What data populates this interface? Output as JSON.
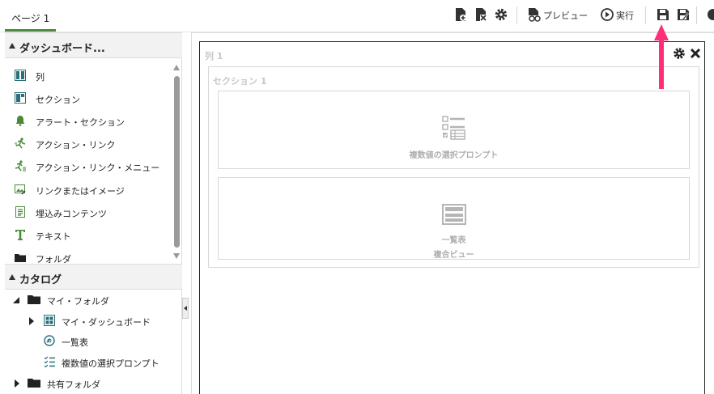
{
  "topbar": {
    "page_tab": "ページ 1",
    "preview_label": "プレビュー",
    "run_label": "実行"
  },
  "components_panel": {
    "title": "ダッシュボード...",
    "items": [
      {
        "label": "列",
        "icon": "column-icon"
      },
      {
        "label": "セクション",
        "icon": "section-icon"
      },
      {
        "label": "アラート・セクション",
        "icon": "bell-icon"
      },
      {
        "label": "アクション・リンク",
        "icon": "action-link-icon"
      },
      {
        "label": "アクション・リンク・メニュー",
        "icon": "action-link-menu-icon"
      },
      {
        "label": "リンクまたはイメージ",
        "icon": "link-image-icon"
      },
      {
        "label": "埋込みコンテンツ",
        "icon": "embedded-content-icon"
      },
      {
        "label": "テキスト",
        "icon": "text-icon"
      },
      {
        "label": "フォルダ",
        "icon": "folder-icon"
      }
    ]
  },
  "catalog_panel": {
    "title": "カタログ",
    "items": [
      {
        "label": "マイ・フォルダ",
        "icon": "folder-icon"
      },
      {
        "label": "マイ・ダッシュボード",
        "icon": "dashboard-icon"
      },
      {
        "label": "一覧表",
        "icon": "analysis-icon"
      },
      {
        "label": "複数値の選択プロンプト",
        "icon": "prompt-icon"
      },
      {
        "label": "共有フォルダ",
        "icon": "folder-icon"
      }
    ]
  },
  "canvas": {
    "column_label": "列 1",
    "section_label": "セクション 1",
    "views": [
      {
        "label": "複数値の選択プロンプト",
        "icon": "prompt-view-icon"
      },
      {
        "label": "一覧表",
        "sublabel": "複合ビュー",
        "icon": "table-view-icon"
      }
    ]
  },
  "colors": {
    "accent_green": "#4a8a3b",
    "annotation_arrow": "#ff2d7a",
    "icon_teal": "#2a6f7a"
  }
}
